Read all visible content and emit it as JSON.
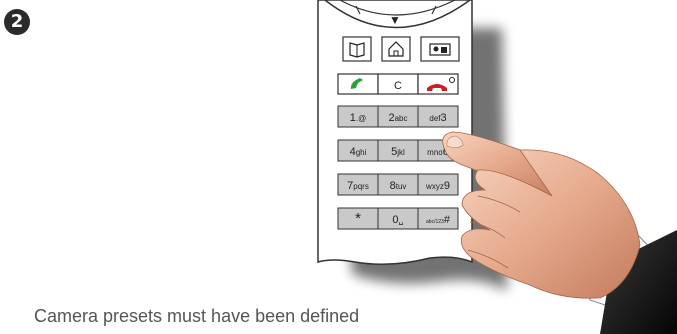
{
  "step": {
    "number": "2"
  },
  "caption": "Camera presets must have been defined",
  "remote": {
    "nav_arrow": "▼",
    "top_buttons": [
      "phonebook-icon",
      "home-icon",
      "presets-icon"
    ],
    "call_row": {
      "call_icon": "call-icon",
      "clear_label": "C",
      "end_icon": "end-call-icon"
    },
    "keypad": [
      {
        "main": "1",
        "sub": ".@"
      },
      {
        "main": "2",
        "sub": "abc"
      },
      {
        "main": "3",
        "sub": "def"
      },
      {
        "main": "4",
        "sub": "ghi"
      },
      {
        "main": "5",
        "sub": "jkl"
      },
      {
        "main": "6",
        "sub": "mno"
      },
      {
        "main": "7",
        "sub": "pqrs"
      },
      {
        "main": "8",
        "sub": "tuv"
      },
      {
        "main": "9",
        "sub": "wxyz"
      },
      {
        "main": "*",
        "sub": ""
      },
      {
        "main": "0",
        "sub": "␣"
      },
      {
        "main": "#",
        "sub": "abc/123"
      }
    ]
  },
  "colors": {
    "call_green": "#2e9e3e",
    "end_red": "#cc1f1f",
    "key_gray": "#c9c9c9"
  }
}
